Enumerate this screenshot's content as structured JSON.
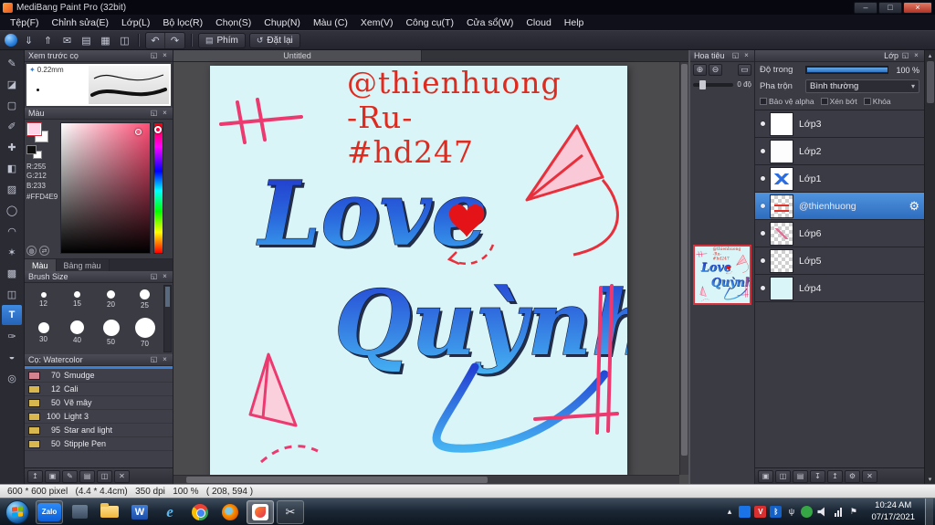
{
  "window": {
    "title": "MediBang Paint Pro (32bit)"
  },
  "menu": {
    "items": [
      "Tệp(F)",
      "Chỉnh sửa(E)",
      "Lớp(L)",
      "Bộ lọc(R)",
      "Chọn(S)",
      "Chụp(N)",
      "Màu (C)",
      "Xem(V)",
      "Công cụ(T)",
      "Cửa sổ(W)",
      "Cloud",
      "Help"
    ]
  },
  "icons": {
    "float": "◱",
    "close": "×",
    "undo": "↶",
    "redo": "↷",
    "zoom_in": "⊕",
    "zoom_out": "⊖",
    "fit": "▭",
    "dropdown": "▾",
    "minimize": "–",
    "maximize": "□",
    "window_close": "×",
    "chevron_up": "▴",
    "chevron_down": "▾",
    "gear": "⚙",
    "keyboard": "▤",
    "reset": "↺",
    "scissors": "✂",
    "flag": "⚑",
    "star": "✦",
    "globe": "◍",
    "swap": "⇄"
  },
  "toolbar": {
    "icons": [
      {
        "name": "brush-smooth-icon",
        "glyph": "",
        "cls": "ball"
      },
      {
        "name": "save-icon",
        "glyph": "⇓"
      },
      {
        "name": "publish-icon",
        "glyph": "⇑"
      },
      {
        "name": "comment-icon",
        "glyph": "✉"
      },
      {
        "name": "new-canvas-icon",
        "glyph": "▤"
      },
      {
        "name": "grid-icon",
        "glyph": "▦"
      },
      {
        "name": "layout-icon",
        "glyph": "◫"
      }
    ],
    "phim_label": "Phím",
    "reset_label": "Đặt lại"
  },
  "tools": [
    {
      "name": "pen-tool",
      "glyph": "✎",
      "cls": ""
    },
    {
      "name": "eraser-tool",
      "glyph": "◪",
      "cls": ""
    },
    {
      "name": "marquee-select-tool",
      "glyph": "▢",
      "cls": ""
    },
    {
      "name": "brush-tool",
      "glyph": "✐",
      "cls": ""
    },
    {
      "name": "move-tool",
      "glyph": "✚",
      "cls": ""
    },
    {
      "name": "fill-tool",
      "glyph": "◧",
      "cls": ""
    },
    {
      "name": "gradient-tool",
      "glyph": "▨",
      "cls": ""
    },
    {
      "name": "ellipse-select-tool",
      "glyph": "◯",
      "cls": ""
    },
    {
      "name": "lasso-tool",
      "glyph": "◠",
      "cls": ""
    },
    {
      "name": "magic-wand-tool",
      "glyph": "✶",
      "cls": ""
    },
    {
      "name": "pattern-tool",
      "glyph": "▩",
      "cls": ""
    },
    {
      "name": "divide-tool",
      "glyph": "◫",
      "cls": ""
    },
    {
      "name": "text-tool",
      "glyph": "T",
      "cls": "active"
    },
    {
      "name": "eyedropper-tool",
      "glyph": "✑",
      "cls": ""
    },
    {
      "name": "hand-tool",
      "glyph": "◒",
      "cls": ""
    },
    {
      "name": "zoom-tool",
      "glyph": "◎",
      "cls": ""
    }
  ],
  "brush_preview": {
    "title": "Xem trước cọ",
    "size": "0.22mm"
  },
  "color_panel": {
    "title": "Màu",
    "r": "R:255",
    "g": "G:212",
    "b": "B:233",
    "hex": "#FFD4E9",
    "current_color": "#FFD4E9",
    "tabs": [
      {
        "label": "Màu",
        "cls": "active"
      },
      {
        "label": "Bảng màu",
        "cls": ""
      }
    ]
  },
  "brush_size_panel": {
    "title": "Brush Size",
    "sizes": [
      {
        "label": "12",
        "d": "6px"
      },
      {
        "label": "15",
        "d": "7px"
      },
      {
        "label": "20",
        "d": "9px"
      },
      {
        "label": "25",
        "d": "11px"
      },
      {
        "label": "30",
        "d": "12px"
      },
      {
        "label": "40",
        "d": "15px"
      },
      {
        "label": "50",
        "d": "18px"
      },
      {
        "label": "70",
        "d": "22px"
      }
    ]
  },
  "brush_list_panel": {
    "title": "Cọ: Watercolor",
    "brushes": [
      {
        "num": "70",
        "name": "Smudge",
        "chip": "#d4838f"
      },
      {
        "num": "12",
        "name": "Cali",
        "chip": "#d8b84e"
      },
      {
        "num": "50",
        "name": "Vẽ mây",
        "chip": "#d8b84e"
      },
      {
        "num": "100",
        "name": "Light 3",
        "chip": "#d8b84e"
      },
      {
        "num": "95",
        "name": "Star and light",
        "chip": "#d8b84e"
      },
      {
        "num": "50",
        "name": "Stipple Pen",
        "chip": "#d8b84e"
      }
    ],
    "buttons": [
      {
        "name": "add-brush-button",
        "glyph": "↥"
      },
      {
        "name": "new-brush-button",
        "glyph": "▣"
      },
      {
        "name": "edit-brush-button",
        "glyph": "✎"
      },
      {
        "name": "brush-folder-button",
        "glyph": "▤"
      },
      {
        "name": "brush-menu-button",
        "glyph": "◫"
      },
      {
        "name": "delete-brush-button",
        "glyph": "✕"
      }
    ]
  },
  "canvas": {
    "tab": "Untitled",
    "line1": "@thienhuong",
    "line2": "-Ru-",
    "line3": "#hd247",
    "word1": "Love",
    "word2": "Quỳnh",
    "background_color": "#d9f5f7",
    "text_red": "#de2b20",
    "text_blue_top": "#1f2fc8",
    "text_blue_bottom": "#3fb0f0",
    "accent_pink": "#ec3a70"
  },
  "navigator": {
    "title": "Hoa tiêu",
    "angle": "0 độ"
  },
  "layers_panel": {
    "title": "Lớp",
    "opacity_label": "Độ trong",
    "opacity_value": "100 %",
    "blend_label": "Pha trộn",
    "blend_value": "Bình thường",
    "checkboxes": [
      {
        "label": "Bảo vệ alpha"
      },
      {
        "label": "Xén bớt"
      },
      {
        "label": "Khóa"
      }
    ],
    "items": [
      {
        "name": "Lớp3",
        "thumb": "thumb-white",
        "row_class": ""
      },
      {
        "name": "Lớp2",
        "thumb": "thumb-faint",
        "row_class": ""
      },
      {
        "name": "Lớp1",
        "thumb": "thumb-blue",
        "row_class": ""
      },
      {
        "name": "@thienhuong",
        "thumb": "thumb-red",
        "row_class": "selected"
      },
      {
        "name": "Lớp6",
        "thumb": "thumb-pink",
        "row_class": ""
      },
      {
        "name": "Lớp5",
        "thumb": "thumb-checker",
        "row_class": ""
      },
      {
        "name": "Lớp4",
        "thumb": "thumb-cyan",
        "row_class": ""
      }
    ],
    "buttons": [
      {
        "name": "new-layer-button",
        "glyph": "▣"
      },
      {
        "name": "duplicate-layer-button",
        "glyph": "◫"
      },
      {
        "name": "layer-folder-button",
        "glyph": "▤"
      },
      {
        "name": "merge-down-button",
        "glyph": "↧"
      },
      {
        "name": "move-layer-up-button",
        "glyph": "↥"
      },
      {
        "name": "layer-settings-button",
        "glyph": "⚙"
      },
      {
        "name": "delete-layer-button",
        "glyph": "✕"
      }
    ],
    "accent_color": "#3e86d8"
  },
  "status": {
    "text": "600 * 600 pixel   (4.4 * 4.4cm)   350 dpi   100 %   ( 208, 594 )"
  },
  "taskbar": {
    "zalo": "Zalo",
    "word": "W",
    "ie": "e",
    "unikey": "V",
    "time": "10:24 AM",
    "date": "07/17/2021"
  }
}
